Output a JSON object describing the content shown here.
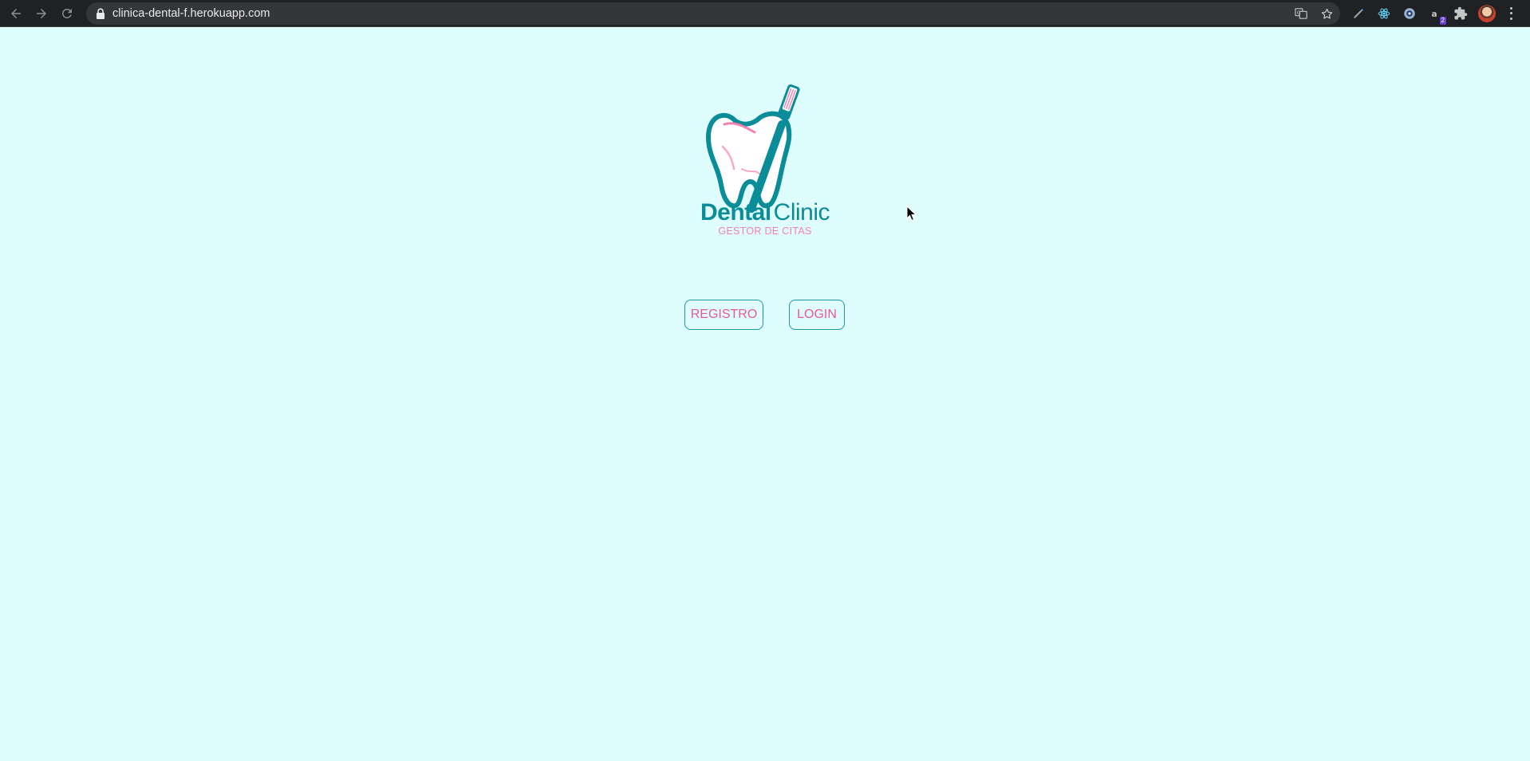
{
  "browser": {
    "url": "clinica-dental-f.herokuapp.com",
    "icons": {
      "back": "arrow-left-icon",
      "forward": "arrow-right-icon",
      "reload": "reload-icon",
      "lock": "lock-icon",
      "translate": "translate-icon",
      "bookmark": "star-icon",
      "extensions": [
        "pen-extension-icon",
        "react-devtools-icon",
        "circle-extension-icon",
        "amazon-extension-icon",
        "puzzle-icon"
      ],
      "amazon_badge": "2",
      "profile": "avatar",
      "menu": "kebab-menu-icon"
    }
  },
  "brand": {
    "name_bold": "Dental",
    "name_light": "Clinic",
    "tagline": "GESTOR DE CITAS",
    "colors": {
      "teal": "#0b8d99",
      "pink": "#f47fb0",
      "background": "#e0fdfe"
    }
  },
  "actions": {
    "register_label": "REGISTRO",
    "login_label": "LOGIN",
    "border_color": "#1a9aa4",
    "text_color": "#e8579a"
  }
}
